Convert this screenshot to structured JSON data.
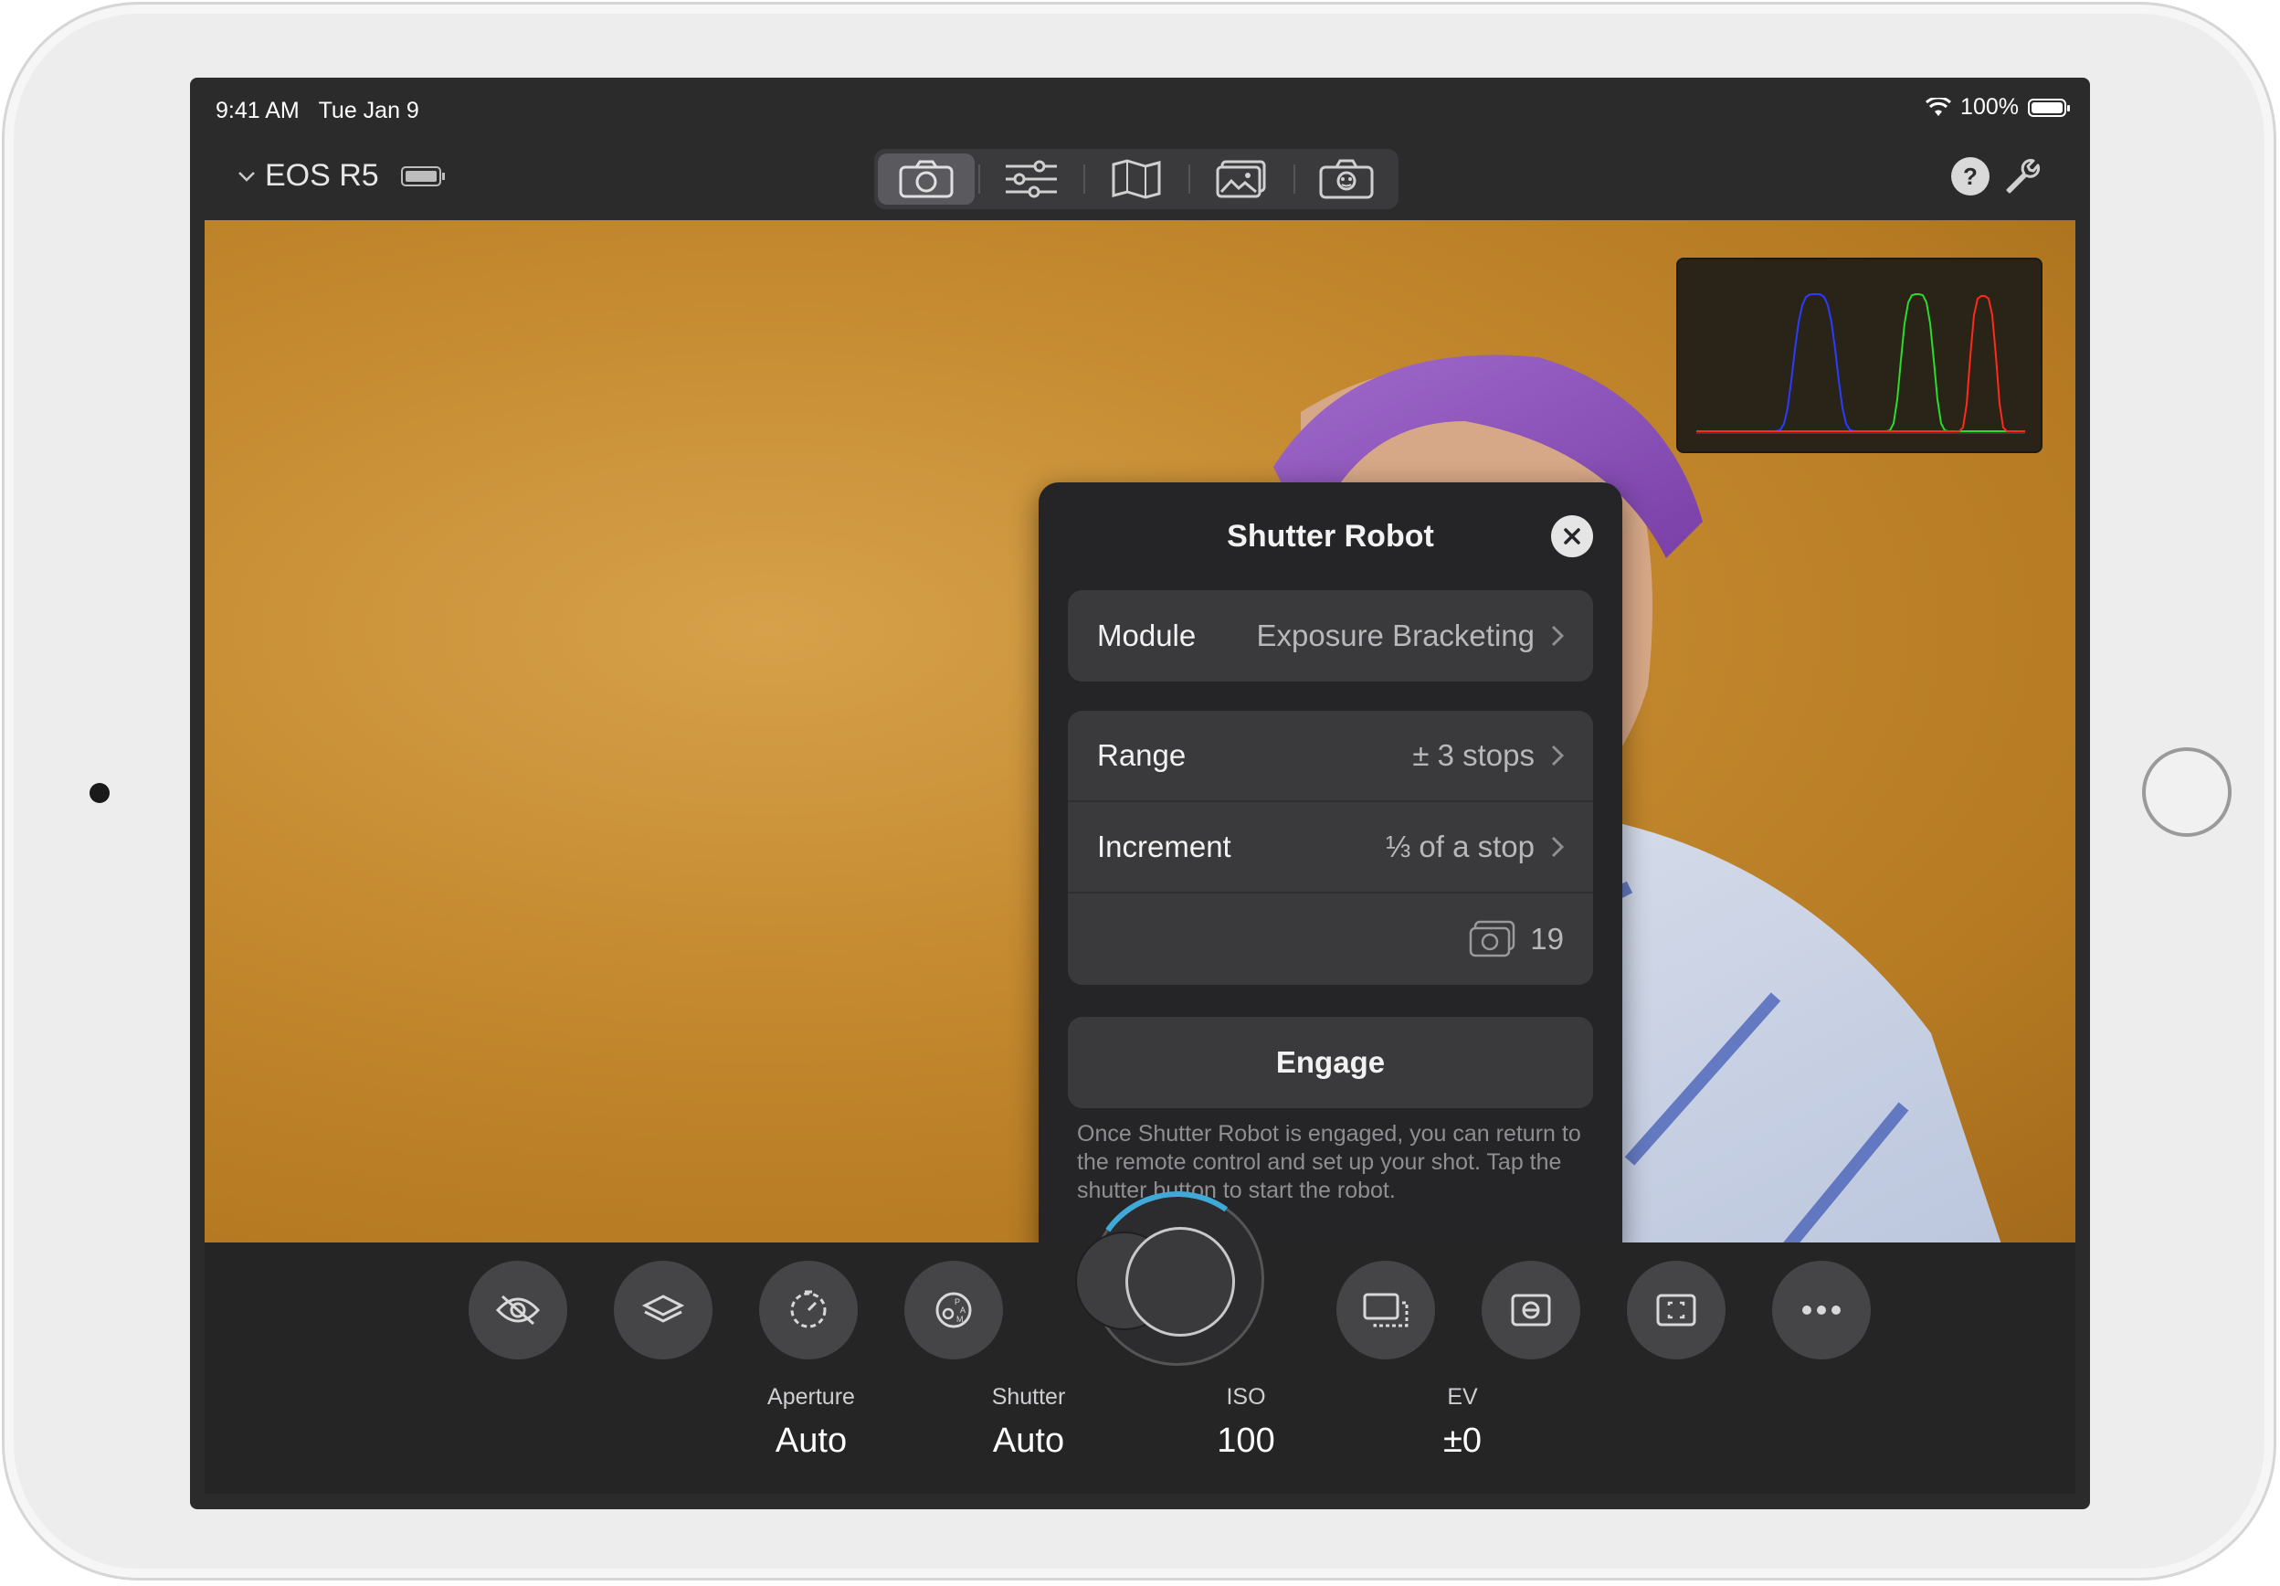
{
  "status": {
    "time": "9:41 AM",
    "date": "Tue Jan 9",
    "battery": "100%"
  },
  "toolbar": {
    "camera_name": "EOS R5",
    "help_label": "?",
    "tabs": [
      "camera-icon",
      "sliders-icon",
      "map-icon",
      "photos-icon",
      "robot-camera-icon"
    ]
  },
  "dialog": {
    "title": "Shutter Robot",
    "module_label": "Module",
    "module_value": "Exposure Bracketing",
    "range_label": "Range",
    "range_value": "± 3 stops",
    "increment_label": "Increment",
    "increment_value": "⅓ of a stop",
    "shot_count": "19",
    "engage_label": "Engage",
    "note": "Once Shutter Robot is engaged, you can return to the remote control and set up your shot. Tap the shutter button to start the robot."
  },
  "exposure": {
    "aperture_label": "Aperture",
    "aperture_value": "Auto",
    "shutter_label": "Shutter",
    "shutter_value": "Auto",
    "iso_label": "ISO",
    "iso_value": "100",
    "ev_label": "EV",
    "ev_value": "±0"
  },
  "colors": {
    "histogram_blue": "#2a3cff",
    "histogram_green": "#2bdc2b",
    "histogram_red": "#ff2a1a",
    "accent": "#3fa9d8"
  }
}
